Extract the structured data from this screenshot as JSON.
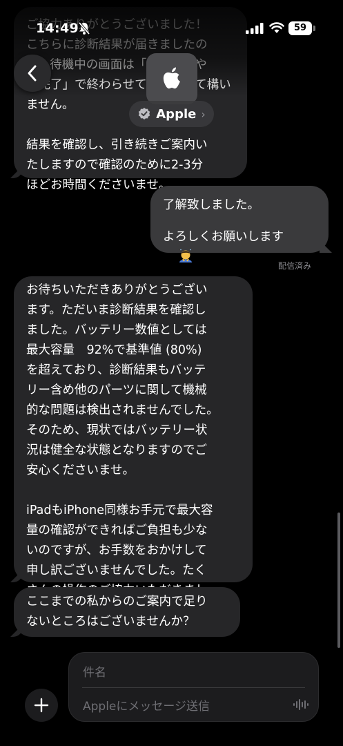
{
  "status_bar": {
    "time": "14:49",
    "battery": "59"
  },
  "header": {
    "contact_name": "Apple",
    "verified": true
  },
  "messages": [
    {
      "direction": "incoming",
      "text": "ご協力ありがとうございました！\nこちらに診断結果が届きましたの\nで、待機中の画面は「閉じる」や\n「完了」で終わらせていただいて構い\nません。\n\n結果を確認し、引き続きご案内い\nたしますので確認のために2-3分\nほどお時間くださいませ。"
    },
    {
      "direction": "outgoing",
      "text_line1": "了解致しました。",
      "text_line2": "よろしくお願いします",
      "status": "配信済み"
    },
    {
      "direction": "incoming",
      "text": "お待ちいただきありがとうござい\nます。ただいま診断結果を確認し\nました。バッテリー数値としては\n最大容量　92%で基準値 (80%)\nを超えており、診断結果もバッテ\nリー含め他のパーツに関して機械\n的な問題は検出されませんでした。\nそのため、現状ではバッテリー状\n況は健全な状態となりますのでご\n安心くださいませ。\n\niPadもiPhone同様お手元で最大容\n量の確認ができればご負担も少な\nいのですが、お手数をおかけして\n申し訳ございませんでした。たく\nさんの操作のご協力いただきまし\nてありがとうございました。"
    },
    {
      "direction": "incoming",
      "text": "ここまでの私からのご案内で足り\nないところはございませんか？"
    }
  ],
  "compose": {
    "subject_placeholder": "件名",
    "message_placeholder": "Appleにメッセージ送信"
  },
  "colors": {
    "incoming_bubble": "#262628",
    "outgoing_bubble": "#3a3a3c",
    "background": "#000000"
  }
}
